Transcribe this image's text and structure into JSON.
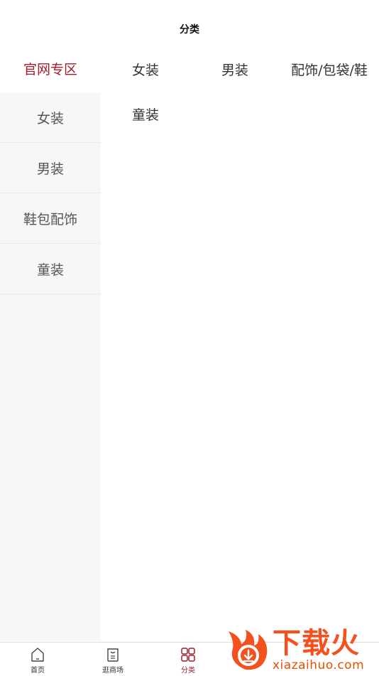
{
  "header": {
    "title": "分类"
  },
  "sidebar": {
    "items": [
      {
        "label": "官网专区",
        "active": true
      },
      {
        "label": "女装",
        "active": false
      },
      {
        "label": "男装",
        "active": false
      },
      {
        "label": "鞋包配饰",
        "active": false
      },
      {
        "label": "童装",
        "active": false
      }
    ]
  },
  "content": {
    "categories": [
      "女装",
      "男装",
      "配饰/包袋/鞋",
      "童装"
    ]
  },
  "tabbar": {
    "items": [
      {
        "label": "首页",
        "icon": "home-icon"
      },
      {
        "label": "逛商场",
        "icon": "bag-icon"
      },
      {
        "label": "分类",
        "icon": "category-grid-icon",
        "active": true
      }
    ]
  },
  "watermark": {
    "main": "下载火",
    "sub": "xiazaihuo.com"
  },
  "colors": {
    "accent": "#a21d2c",
    "sidebar_bg": "#f7f7f7",
    "watermark": "#f4511e"
  }
}
